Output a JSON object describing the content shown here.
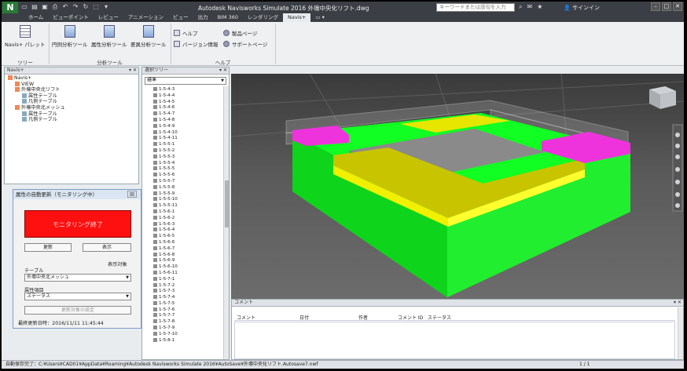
{
  "app": {
    "logo_letter": "N",
    "window_title": "Autodesk Navisworks Simulate 2016   外壕中央化リフト.dwg",
    "search_placeholder": "キーワードまたは語句を入力",
    "signin_label": "サインイン"
  },
  "menu_tabs": [
    "ホーム",
    "ビューポイント",
    "レビュー",
    "アニメーション",
    "ビュー",
    "出力",
    "BIM 360",
    "レンダリング",
    "Navis+",
    "▭ ▾"
  ],
  "active_tab_index": 8,
  "ribbon": {
    "palette_label": "Navis+ パレット",
    "circle_tool": "円例分析ツール",
    "attr_tool": "属性分析ツール",
    "diff_tool": "差異分析ツール",
    "help": "ヘルプ",
    "version": "バージョン情報",
    "product_page": "製品ページ",
    "support_page": "サポートページ",
    "group_tree": "ツリー",
    "group_analysis": "分析ツール",
    "group_help": "ヘルプ"
  },
  "navis_panel": {
    "title": "Navis+",
    "items": [
      {
        "label": "Navis+",
        "level": 0
      },
      {
        "label": "VIEW",
        "level": 1
      },
      {
        "label": "外壕中央北リフト",
        "level": 1
      },
      {
        "label": "属性テーブル",
        "level": 2
      },
      {
        "label": "凡例テーブル",
        "level": 2
      },
      {
        "label": "外壕中央北メッシュ",
        "level": 1
      },
      {
        "label": "属性テーブル",
        "level": 2
      },
      {
        "label": "凡例テーブル",
        "level": 2
      }
    ]
  },
  "selection_tree": {
    "title": "選択ツリー",
    "dropdown": "標準",
    "items": [
      "1-5-4-3",
      "1-5-4-4",
      "1-5-4-5",
      "1-5-4-6",
      "1-5-4-7",
      "1-5-4-8",
      "1-5-4-9",
      "1-5-4-10",
      "1-5-4-11",
      "1-5-5-1",
      "1-5-5-2",
      "1-5-5-3",
      "1-5-5-4",
      "1-5-5-5",
      "1-5-5-6",
      "1-5-5-7",
      "1-5-5-8",
      "1-5-5-9",
      "1-5-5-10",
      "1-5-5-11",
      "1-5-6-1",
      "1-5-6-2",
      "1-5-6-3",
      "1-5-6-4",
      "1-5-6-5",
      "1-5-6-6",
      "1-5-6-7",
      "1-5-6-8",
      "1-5-6-9",
      "1-5-6-10",
      "1-5-6-11",
      "1-5-7-1",
      "1-5-7-2",
      "1-5-7-3",
      "1-5-7-4",
      "1-5-7-5",
      "1-5-7-6",
      "1-5-7-7",
      "1-5-7-8",
      "1-5-7-9",
      "1-5-7-10",
      "1-5-8-1"
    ]
  },
  "dialog": {
    "title": "属性の自動更新（モニタリング中）",
    "close": "☒",
    "stop_button": "モニタリング終了",
    "update_button": "更新",
    "display_button": "表示",
    "display_target": "表示対象",
    "table_label": "テーブル",
    "table_value": "外壕中央北メッシュ",
    "attr_label": "属性項目",
    "attr_value": "ステータス",
    "update_settings": "更新対象の設定",
    "last_update": "最終更新日時：2016/11/11 11:45:44"
  },
  "comments_panel": {
    "title": "コメント",
    "columns": [
      "コメント",
      "日付",
      "作者",
      "コメント ID",
      "ステータス"
    ]
  },
  "status_bar": {
    "text": "自動保存完了：C:¥Users¥CAD01¥AppData¥Roaming¥Autodesk Navisworks Simulate 2016¥AutoSave¥外壕中央化リフト.Autosave7.nwf",
    "page": "1 / 1"
  },
  "colors": {
    "monitor_red": "#ff1010",
    "block_green": "#11ff22",
    "block_yellow": "#f0f000",
    "block_magenta": "#ee33dd"
  }
}
